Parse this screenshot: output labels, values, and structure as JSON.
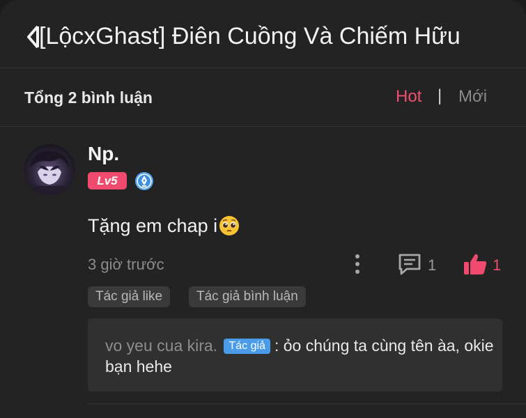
{
  "header": {
    "back_icon": "chevron-left-icon",
    "title": "[LộcxGhast] Điên Cuồng Và Chiếm Hữu"
  },
  "comments_bar": {
    "total_label": "Tổng 2 bình luận",
    "sort_hot": "Hot",
    "separator": "|",
    "sort_new": "Mới",
    "active_color": "#f0506e"
  },
  "comment": {
    "avatar_icon": "avatar",
    "username": "Np.",
    "level": "Lv5",
    "badge_icon": "verified-pen-icon",
    "text": "Tặng em chap i",
    "emoji": "pleading-face-emoji",
    "time": "3 giờ trước",
    "more_icon": "more-vertical-icon",
    "reply_icon": "comment-icon",
    "reply_count": "1",
    "like_icon": "thumbs-up-icon",
    "like_count": "1",
    "like_color": "#f04a6e",
    "tags": [
      "Tác giả like",
      "Tác giả bình luận"
    ]
  },
  "reply": {
    "author": "vo yeu cua kira.",
    "author_badge": "Tác giả",
    "separator": ":",
    "text": "ỏo chúng ta cùng tên àa, okie bạn hehe",
    "badge_color": "#4a9ce8"
  }
}
